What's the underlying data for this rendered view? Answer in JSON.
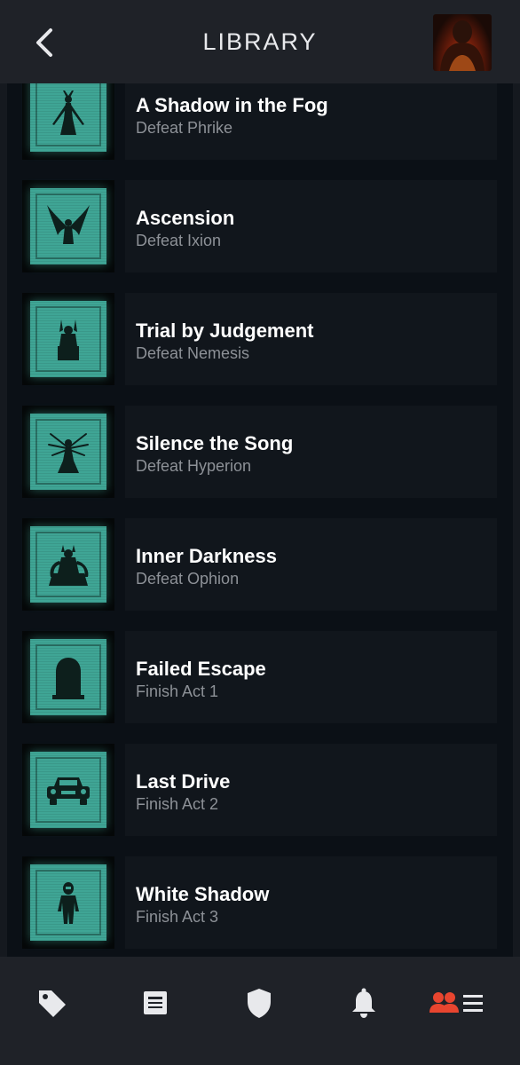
{
  "header": {
    "title": "LIBRARY",
    "back_icon": "chevron-left-icon",
    "avatar": "player-avatar"
  },
  "achievements": [
    {
      "title": "A Shadow in the Fog",
      "subtitle": "Defeat Phrike",
      "icon": "phrike-icon"
    },
    {
      "title": "Ascension",
      "subtitle": "Defeat Ixion",
      "icon": "ixion-icon"
    },
    {
      "title": "Trial by Judgement",
      "subtitle": "Defeat Nemesis",
      "icon": "nemesis-icon"
    },
    {
      "title": "Silence the Song",
      "subtitle": "Defeat Hyperion",
      "icon": "hyperion-icon"
    },
    {
      "title": "Inner Darkness",
      "subtitle": "Defeat Ophion",
      "icon": "ophion-icon"
    },
    {
      "title": "Failed Escape",
      "subtitle": "Finish Act 1",
      "icon": "tombstone-icon"
    },
    {
      "title": "Last Drive",
      "subtitle": "Finish Act 2",
      "icon": "car-icon"
    },
    {
      "title": "White Shadow",
      "subtitle": "Finish Act 3",
      "icon": "astronaut-icon"
    }
  ],
  "bottom_nav": [
    {
      "icon": "tag-icon",
      "active": false
    },
    {
      "icon": "news-icon",
      "active": false
    },
    {
      "icon": "shield-icon",
      "active": false
    },
    {
      "icon": "bell-icon",
      "active": false
    },
    {
      "icon": "friends-list-icon",
      "active": true
    }
  ],
  "colors": {
    "header_bg": "#1f2228",
    "list_bg": "#0b1016",
    "card_bg": "#11161c",
    "icon_teal": "#3fa595",
    "accent_red": "#e8452f",
    "text_primary": "#ffffff",
    "text_secondary": "#8d9197"
  }
}
